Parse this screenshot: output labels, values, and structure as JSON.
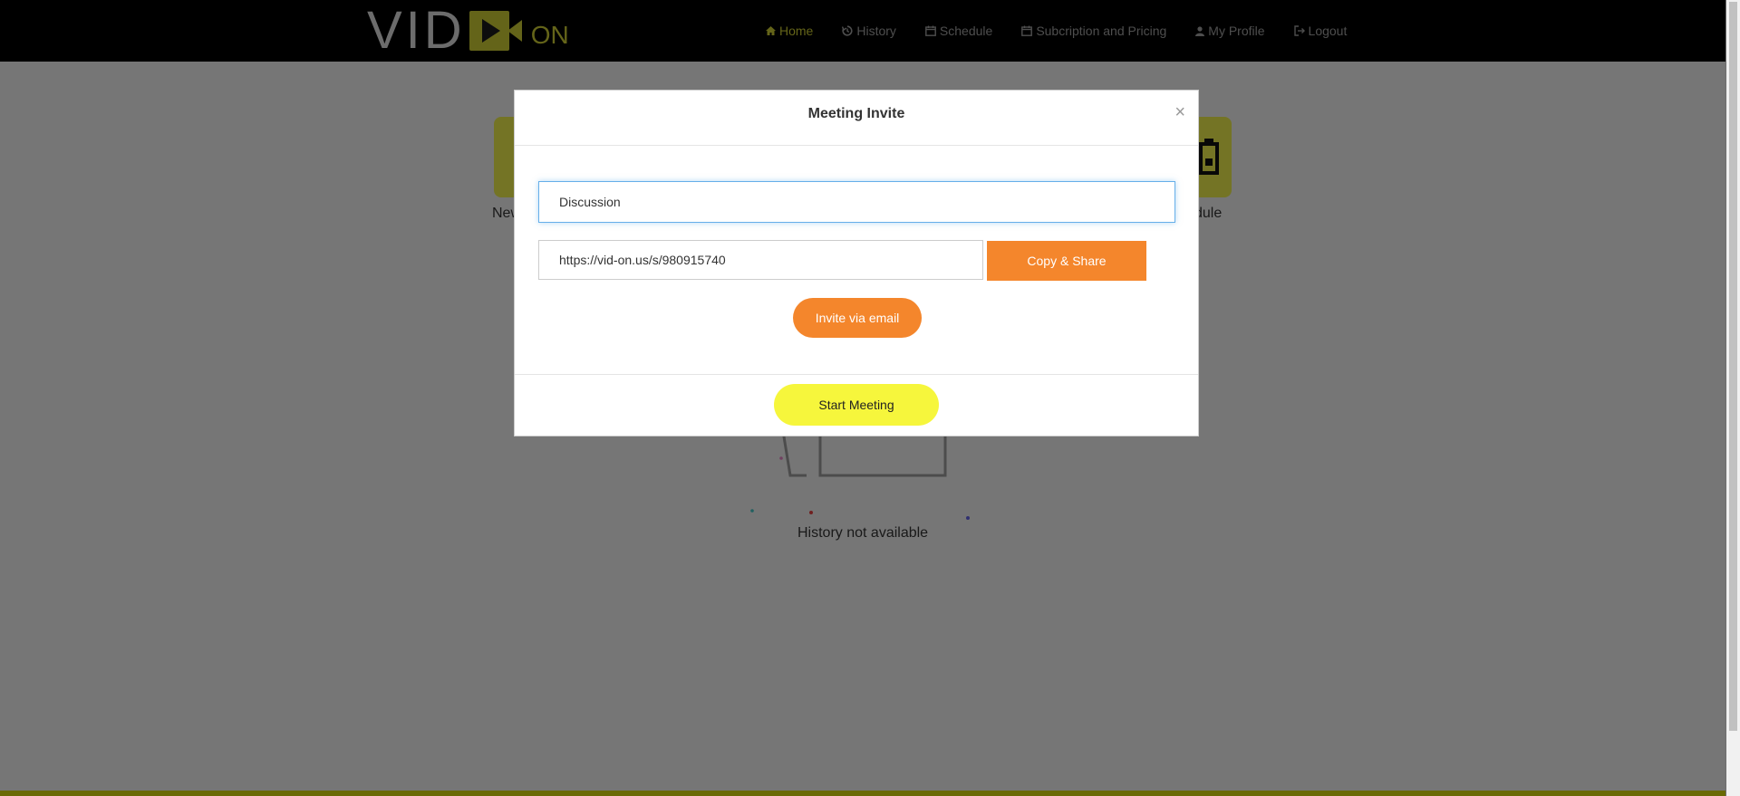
{
  "brand": {
    "logo_text": "VID ON"
  },
  "nav": {
    "home": "Home",
    "history": "History",
    "schedule": "Schedule",
    "pricing": "Subcription and Pricing",
    "profile": "My Profile",
    "logout": "Logout"
  },
  "background": {
    "tile_left_label": "New",
    "tile_right_label": "dule",
    "history_empty": "History not available"
  },
  "modal": {
    "title": "Meeting Invite",
    "close": "×",
    "topic_value": "Discussion",
    "link_value": "https://vid-on.us/s/980915740",
    "copy_button": "Copy & Share",
    "invite_button": "Invite via email",
    "start_button": "Start Meeting"
  },
  "colors": {
    "accent_yellow": "#c8c832",
    "button_orange": "#f4862c",
    "start_yellow": "#f6f63c"
  }
}
